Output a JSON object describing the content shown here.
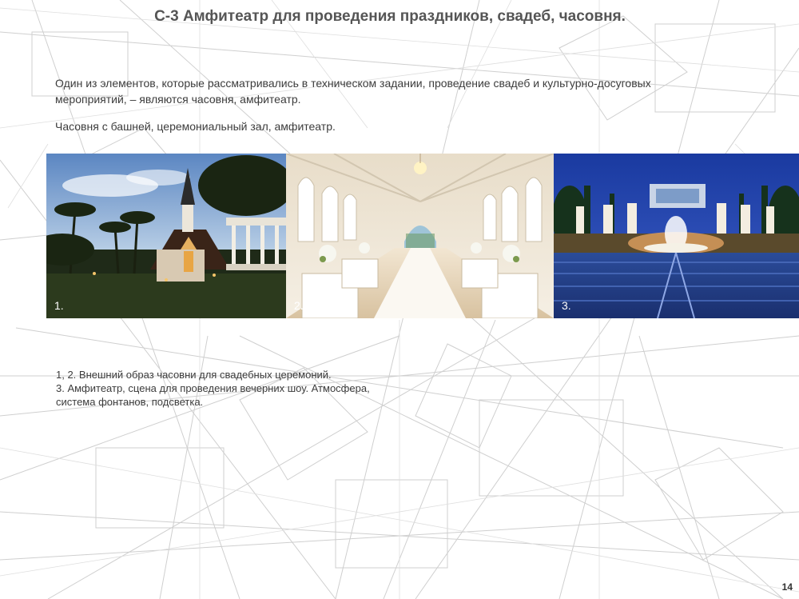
{
  "title": "С-3 Амфитеатр для проведения праздников, свадеб, часовня.",
  "intro": "Один из элементов, которые рассматривались в техническом задании, проведение свадеб и культурно-досуговых мероприятий, – являются часовня, амфитеатр.",
  "subtitle": "Часовня с башней, церемониальный зал, амфитеатр.",
  "photos": [
    {
      "number": "1.",
      "icon": "chapel-exterior-photo"
    },
    {
      "number": "2.",
      "icon": "ceremony-hall-interior-photo"
    },
    {
      "number": "3.",
      "icon": "amphitheater-fountain-photo"
    }
  ],
  "caption": {
    "line1": "1, 2. Внешний образ часовни для свадебных церемоний.",
    "line2": "3. Амфитеатр, сцена для проведения вечерних шоу. Атмосфера,\nсистема фонтанов, подсветка."
  },
  "page_number": "14"
}
